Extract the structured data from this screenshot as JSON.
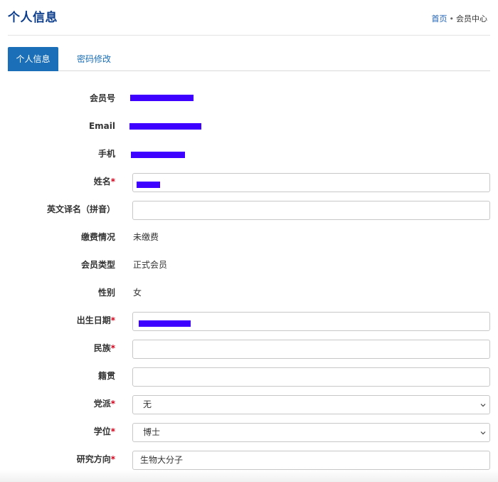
{
  "header": {
    "title": "个人信息",
    "breadcrumb": {
      "home": "首页",
      "separator": "•",
      "current": "会员中心"
    }
  },
  "tabs": [
    {
      "label": "个人信息",
      "active": true
    },
    {
      "label": "密码修改",
      "active": false
    }
  ],
  "form": {
    "member_no": {
      "label": "会员号"
    },
    "email": {
      "label": "Email"
    },
    "phone": {
      "label": "手机"
    },
    "name": {
      "label": "姓名",
      "required": "*"
    },
    "english_name": {
      "label": "英文译名（拼音）",
      "value": ""
    },
    "payment": {
      "label": "缴费情况",
      "value": "未缴费"
    },
    "member_type": {
      "label": "会员类型",
      "value": "正式会员"
    },
    "gender": {
      "label": "性别",
      "value": "女"
    },
    "birth_date": {
      "label": "出生日期",
      "required": "*"
    },
    "ethnicity": {
      "label": "民族",
      "required": "*",
      "value": ""
    },
    "native_place": {
      "label": "籍贯",
      "value": ""
    },
    "party": {
      "label": "党派",
      "required": "*",
      "value": "无"
    },
    "degree": {
      "label": "学位",
      "required": "*",
      "value": "博士"
    },
    "research": {
      "label": "研究方向",
      "required": "*",
      "value": "生物大分子"
    }
  },
  "colors": {
    "accent": "#1a6fb8",
    "title": "#0b3d8c",
    "required": "#d0021b",
    "redaction": "#3e00ff"
  }
}
